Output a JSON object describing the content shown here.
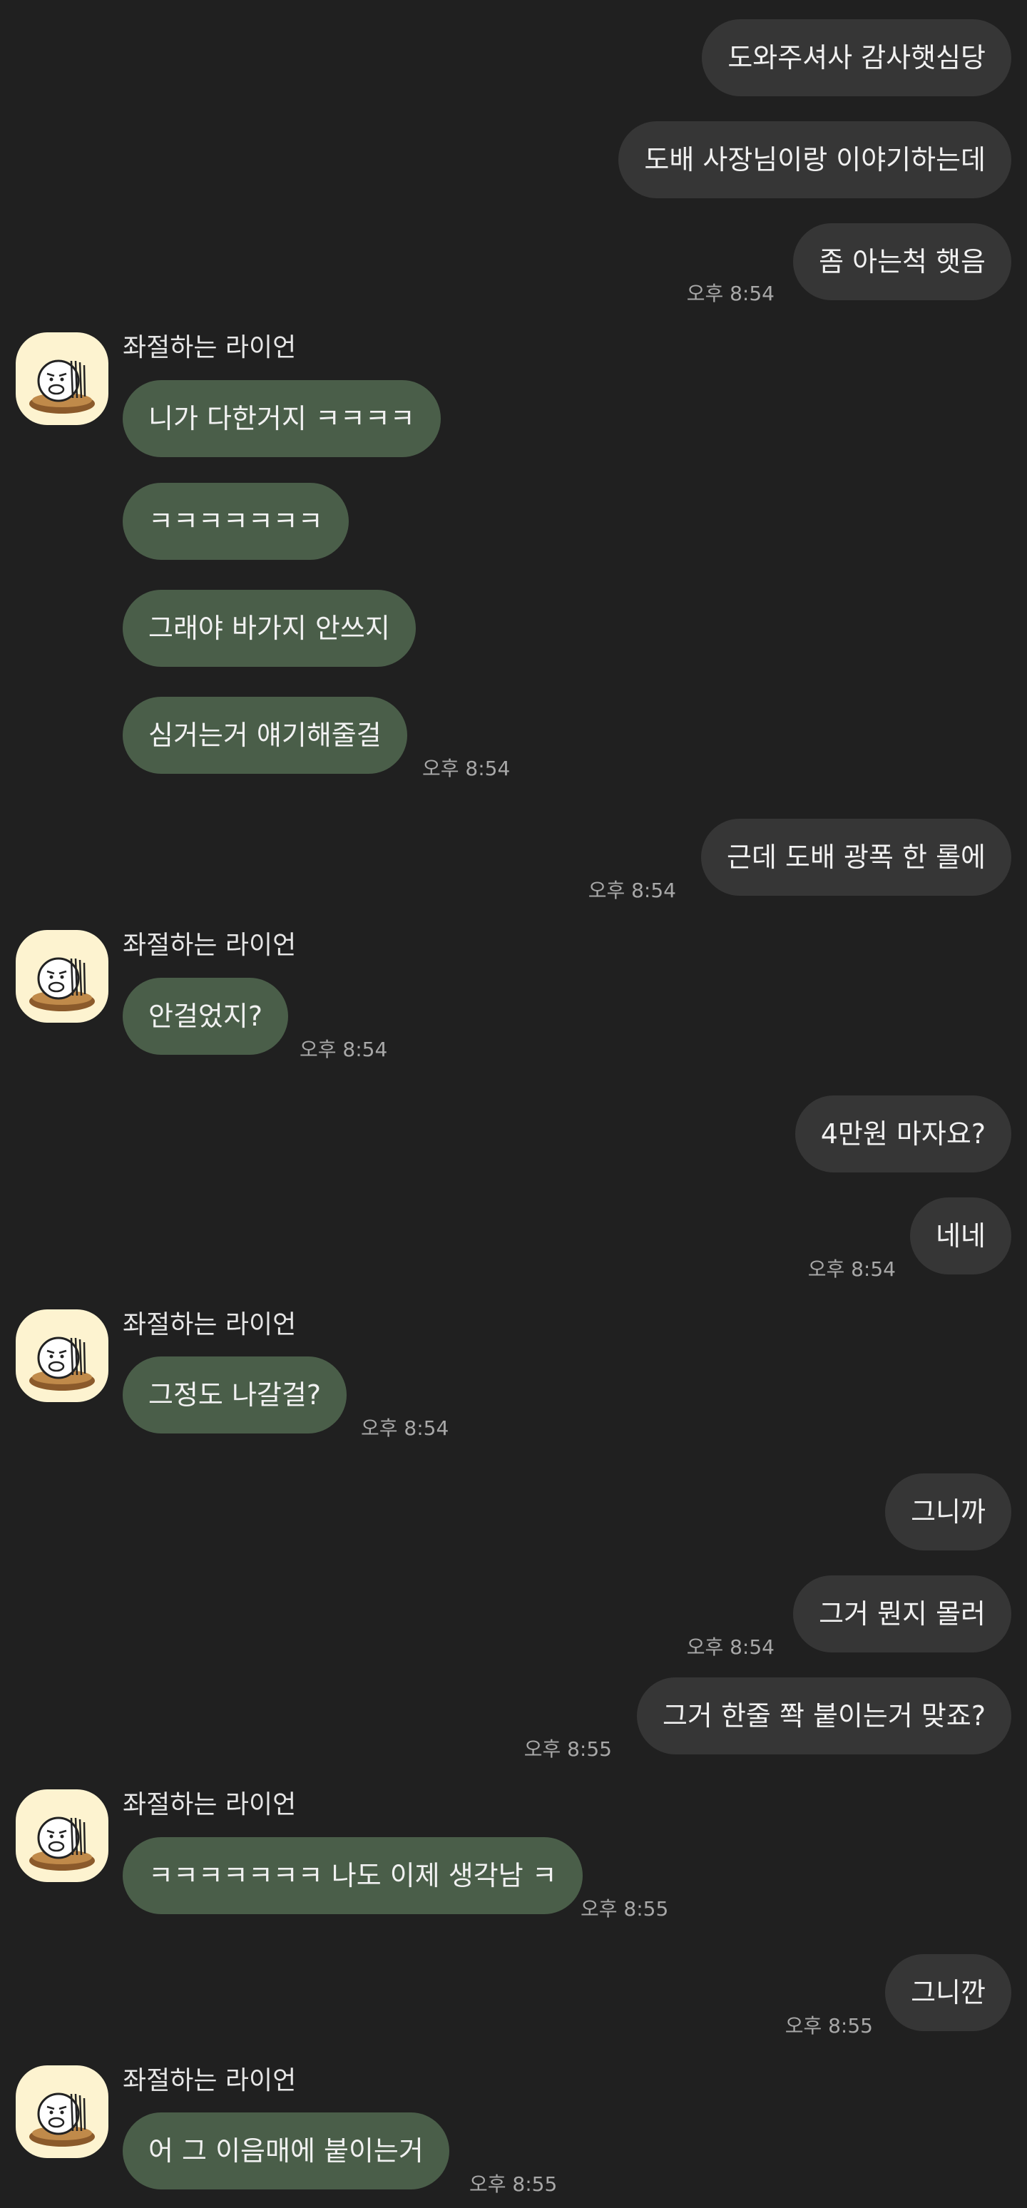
{
  "contact": {
    "name": "좌절하는 라이언",
    "avatar_icon": "ryan-sad-icon"
  },
  "colors": {
    "background": "#202020",
    "outgoing_bubble": "#363636",
    "incoming_bubble": "#4a5e49"
  },
  "messages": [
    {
      "text": "도와주셔사 감사햇심당",
      "time": ""
    },
    {
      "text": "도배 사장님이랑 이야기하는데",
      "time": ""
    },
    {
      "text": "좀 아는척 햇음",
      "time": "오후 8:54"
    },
    {
      "text": "니가 다한거지 ㅋㅋㅋㅋ",
      "time": ""
    },
    {
      "text": "ㅋㅋㅋㅋㅋㅋㅋ",
      "time": ""
    },
    {
      "text": "그래야 바가지 안쓰지",
      "time": ""
    },
    {
      "text": "심거는거 얘기해줄걸",
      "time": "오후 8:54"
    },
    {
      "text": "근데 도배 광폭 한 롤에",
      "time": "오후 8:54"
    },
    {
      "text": "안걸었지?",
      "time": "오후 8:54"
    },
    {
      "text": "4만원 마자요?",
      "time": ""
    },
    {
      "text": "네네",
      "time": "오후 8:54"
    },
    {
      "text": "그정도 나갈걸?",
      "time": "오후 8:54"
    },
    {
      "text": "그니까",
      "time": ""
    },
    {
      "text": "그거 뭔지 몰러",
      "time": "오후 8:54"
    },
    {
      "text": "그거 한줄 쫙 붙이는거 맞죠?",
      "time": "오후 8:55"
    },
    {
      "text": "ㅋㅋㅋㅋㅋㅋㅋ 나도 이제 생각남 ㅋ",
      "time": "오후 8:55"
    },
    {
      "text": "그니깐",
      "time": "오후 8:55"
    },
    {
      "text": "어 그 이음매에 붙이는거",
      "time": "오후 8:55"
    }
  ]
}
